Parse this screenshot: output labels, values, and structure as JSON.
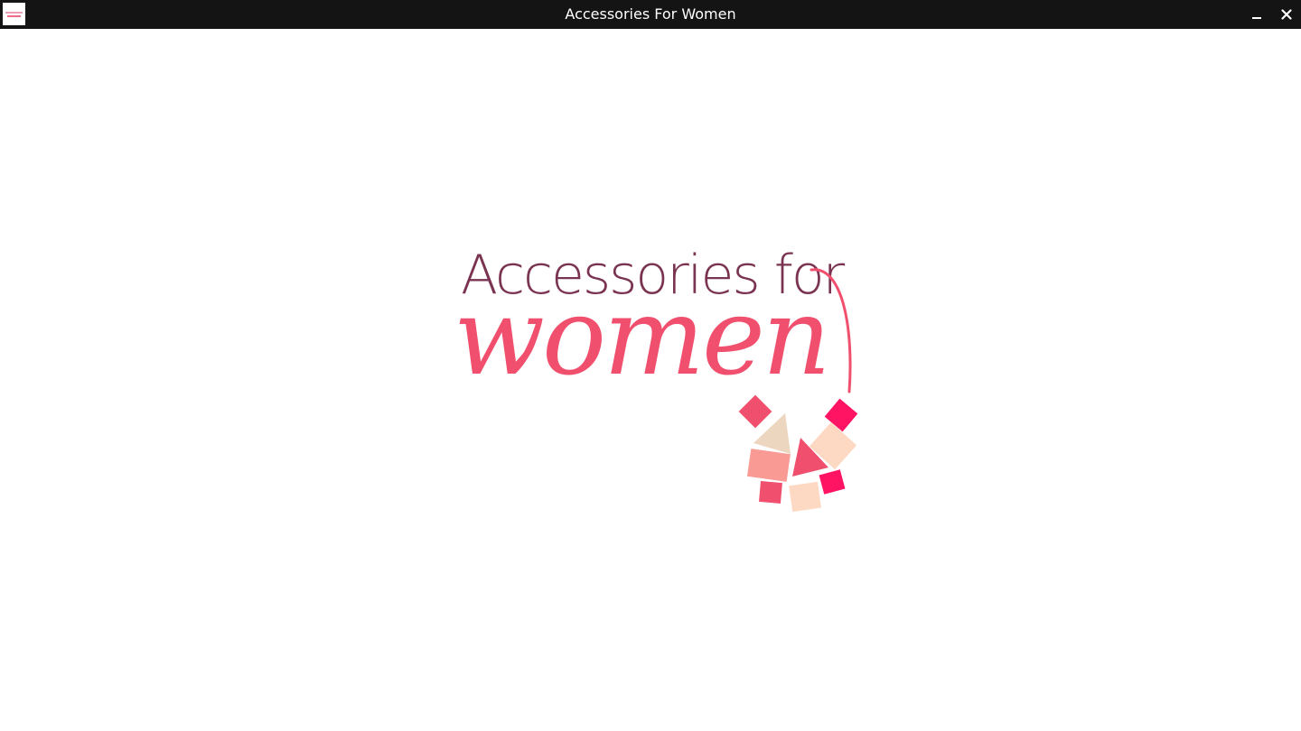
{
  "window": {
    "title": "Accessories For Women",
    "icons": {
      "app": "app-logo-icon",
      "minimize": "minimize-icon",
      "close": "close-icon"
    }
  },
  "splash": {
    "logo_line1": "Accessories for",
    "logo_line2": "women"
  },
  "colors": {
    "titlebar": "#141414",
    "logo_plum": "#7a3350",
    "logo_pink": "#f0506e",
    "logo_hot_pink": "#ff1464",
    "logo_salmon": "#f99a94",
    "logo_peach": "#fdd8c2",
    "logo_beige": "#ecd6bf"
  }
}
